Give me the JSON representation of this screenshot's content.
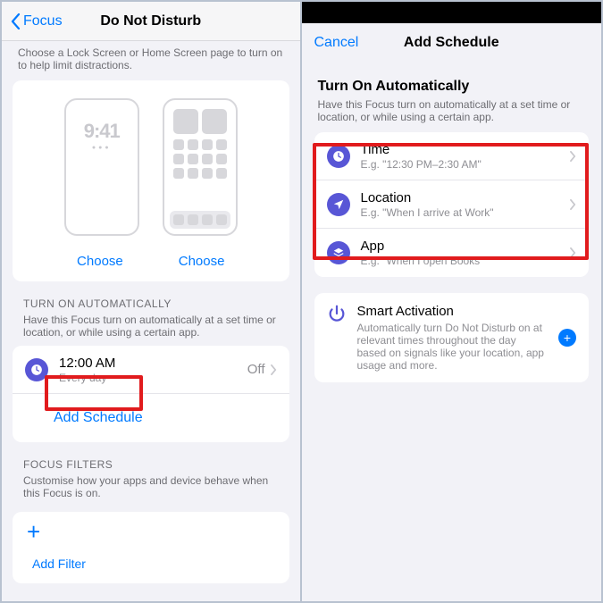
{
  "left": {
    "back_label": "Focus",
    "title": "Do Not Disturb",
    "screens_intro": "Choose a Lock Screen or Home Screen page to turn on to help limit distractions.",
    "lock_time": "9:41",
    "choose_label": "Choose",
    "auto_header": "TURN ON AUTOMATICALLY",
    "auto_sub": "Have this Focus turn on automatically at a set time or location, or while using a certain app.",
    "schedule_time": "12:00 AM",
    "schedule_repeat": "Every day",
    "schedule_state": "Off",
    "add_schedule_label": "Add Schedule",
    "filters_header": "FOCUS FILTERS",
    "filters_sub": "Customise how your apps and device behave when this Focus is on.",
    "add_filter_label": "Add Filter"
  },
  "right": {
    "cancel_label": "Cancel",
    "title": "Add Schedule",
    "auto_title": "Turn On Automatically",
    "auto_sub": "Have this Focus turn on automatically at a set time or location, or while using a certain app.",
    "triggers": [
      {
        "title": "Time",
        "sub": "E.g. \"12:30 PM–2:30 AM\""
      },
      {
        "title": "Location",
        "sub": "E.g. \"When I arrive at Work\""
      },
      {
        "title": "App",
        "sub": "E.g. \"When I open Books\""
      }
    ],
    "smart_title": "Smart Activation",
    "smart_sub": "Automatically turn Do Not Disturb on at relevant times throughout the day based on signals like your location, app usage and more."
  }
}
